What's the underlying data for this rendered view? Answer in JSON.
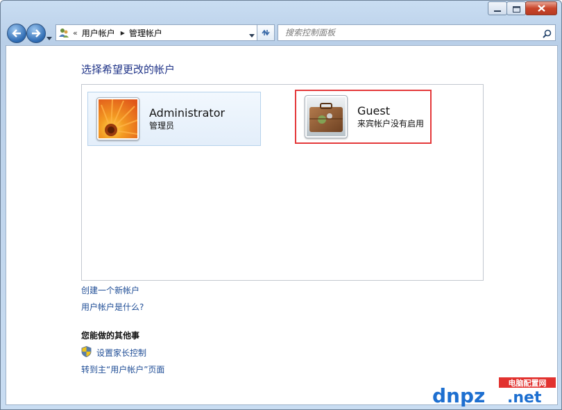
{
  "titlebar": {
    "minimize_icon": "minimize-icon",
    "maximize_icon": "maximize-icon",
    "close_icon": "close-icon"
  },
  "nav": {
    "address_chevron": "«",
    "breadcrumb": [
      "用户帐户",
      "管理帐户"
    ],
    "breadcrumb_separator": "▶",
    "search_placeholder": "搜索控制面板"
  },
  "main": {
    "heading": "选择希望更改的帐户",
    "accounts": [
      {
        "name": "Administrator",
        "role": "管理员",
        "avatar": "flower-avatar"
      },
      {
        "name": "Guest",
        "role": "来宾帐户没有启用",
        "avatar": "suitcase-avatar"
      }
    ],
    "links": [
      "创建一个新帐户",
      "用户帐户是什么?"
    ],
    "other_heading": "您能做的其他事",
    "other_links": [
      "设置家长控制",
      "转到主“用户帐户”页面"
    ]
  },
  "colors": {
    "link": "#1f4d96",
    "heading": "#1e3287",
    "highlight": "#e4383a"
  },
  "watermark": {
    "brand": "dnpz",
    "domain": ".net",
    "tag": "电脑配置网"
  }
}
